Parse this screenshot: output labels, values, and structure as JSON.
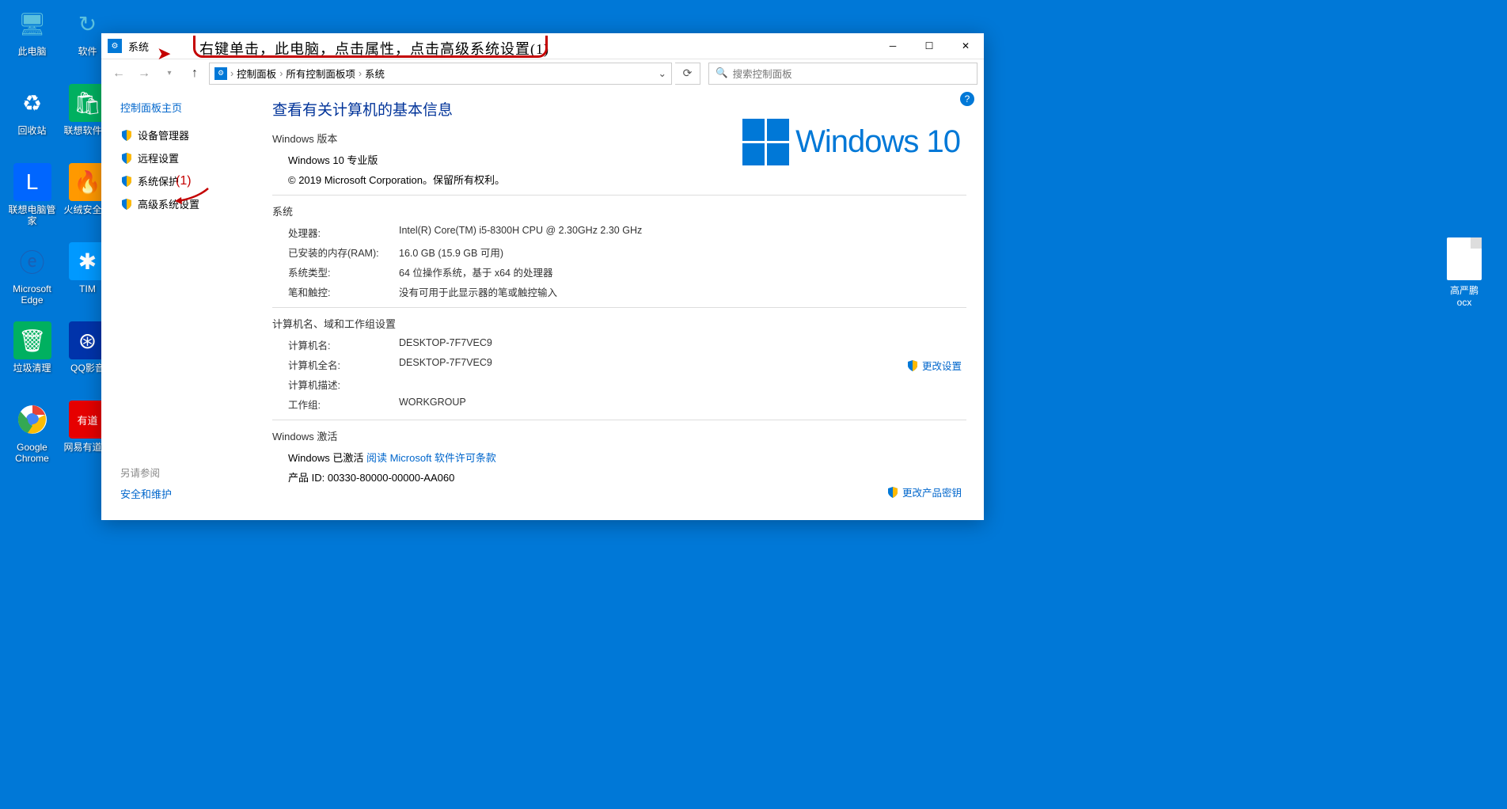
{
  "desktop": {
    "icons": [
      {
        "label": "此电脑",
        "bg": "transparent",
        "glyph": "💻"
      },
      {
        "label": "软件",
        "bg": "#0099cc",
        "glyph": "↻"
      },
      {
        "label": "回收站",
        "bg": "transparent",
        "glyph": "🗑"
      },
      {
        "label": "联想软件商",
        "bg": "#00b060",
        "glyph": "🛍"
      },
      {
        "label": "联想电脑管家",
        "bg": "#0066ff",
        "glyph": "🕒"
      },
      {
        "label": "火绒安全软",
        "bg": "#ff9900",
        "glyph": "🔥"
      },
      {
        "label": "Microsoft Edge",
        "bg": "#1a5fb4",
        "glyph": "e"
      },
      {
        "label": "TIM",
        "bg": "#0099ff",
        "glyph": "✱"
      },
      {
        "label": "垃圾清理",
        "bg": "#00b060",
        "glyph": "🛡"
      },
      {
        "label": "QQ影音",
        "bg": "#0033aa",
        "glyph": "⊛"
      },
      {
        "label": "Google Chrome",
        "bg": "transparent",
        "glyph": "◉"
      },
      {
        "label": "网易有道词",
        "bg": "#e60000",
        "glyph": "有道"
      }
    ],
    "doc_label": "高严鹏\nocx"
  },
  "window": {
    "title": "系统",
    "annotation": "右键单击，此电脑，点击属性，点击高级系统设置(1)",
    "annotation_num": "(1)",
    "breadcrumb": [
      "控制面板",
      "所有控制面板项",
      "系统"
    ],
    "search_placeholder": "搜索控制面板",
    "sidebar": {
      "home": "控制面板主页",
      "items": [
        "设备管理器",
        "远程设置",
        "系统保护",
        "高级系统设置"
      ],
      "see_also": "另请参阅",
      "security": "安全和维护"
    },
    "main": {
      "heading": "查看有关计算机的基本信息",
      "edition_title": "Windows 版本",
      "edition": "Windows 10 专业版",
      "copyright": "© 2019 Microsoft Corporation。保留所有权利。",
      "logo_text": "Windows 10",
      "system_title": "系统",
      "system_rows": [
        {
          "k": "处理器:",
          "v": "Intel(R) Core(TM) i5-8300H CPU @ 2.30GHz   2.30 GHz"
        },
        {
          "k": "已安装的内存(RAM):",
          "v": "16.0 GB (15.9 GB 可用)"
        },
        {
          "k": "系统类型:",
          "v": "64 位操作系统，基于 x64 的处理器"
        },
        {
          "k": "笔和触控:",
          "v": "没有可用于此显示器的笔或触控输入"
        }
      ],
      "computer_title": "计算机名、域和工作组设置",
      "computer_rows": [
        {
          "k": "计算机名:",
          "v": "DESKTOP-7F7VEC9"
        },
        {
          "k": "计算机全名:",
          "v": "DESKTOP-7F7VEC9"
        },
        {
          "k": "计算机描述:",
          "v": ""
        },
        {
          "k": "工作组:",
          "v": "WORKGROUP"
        }
      ],
      "change_settings": "更改设置",
      "activation_title": "Windows 激活",
      "activation_status": "Windows 已激活  ",
      "license_link": "阅读 Microsoft 软件许可条款",
      "product_id": "产品 ID: 00330-80000-00000-AA060",
      "change_key": "更改产品密钥"
    }
  }
}
